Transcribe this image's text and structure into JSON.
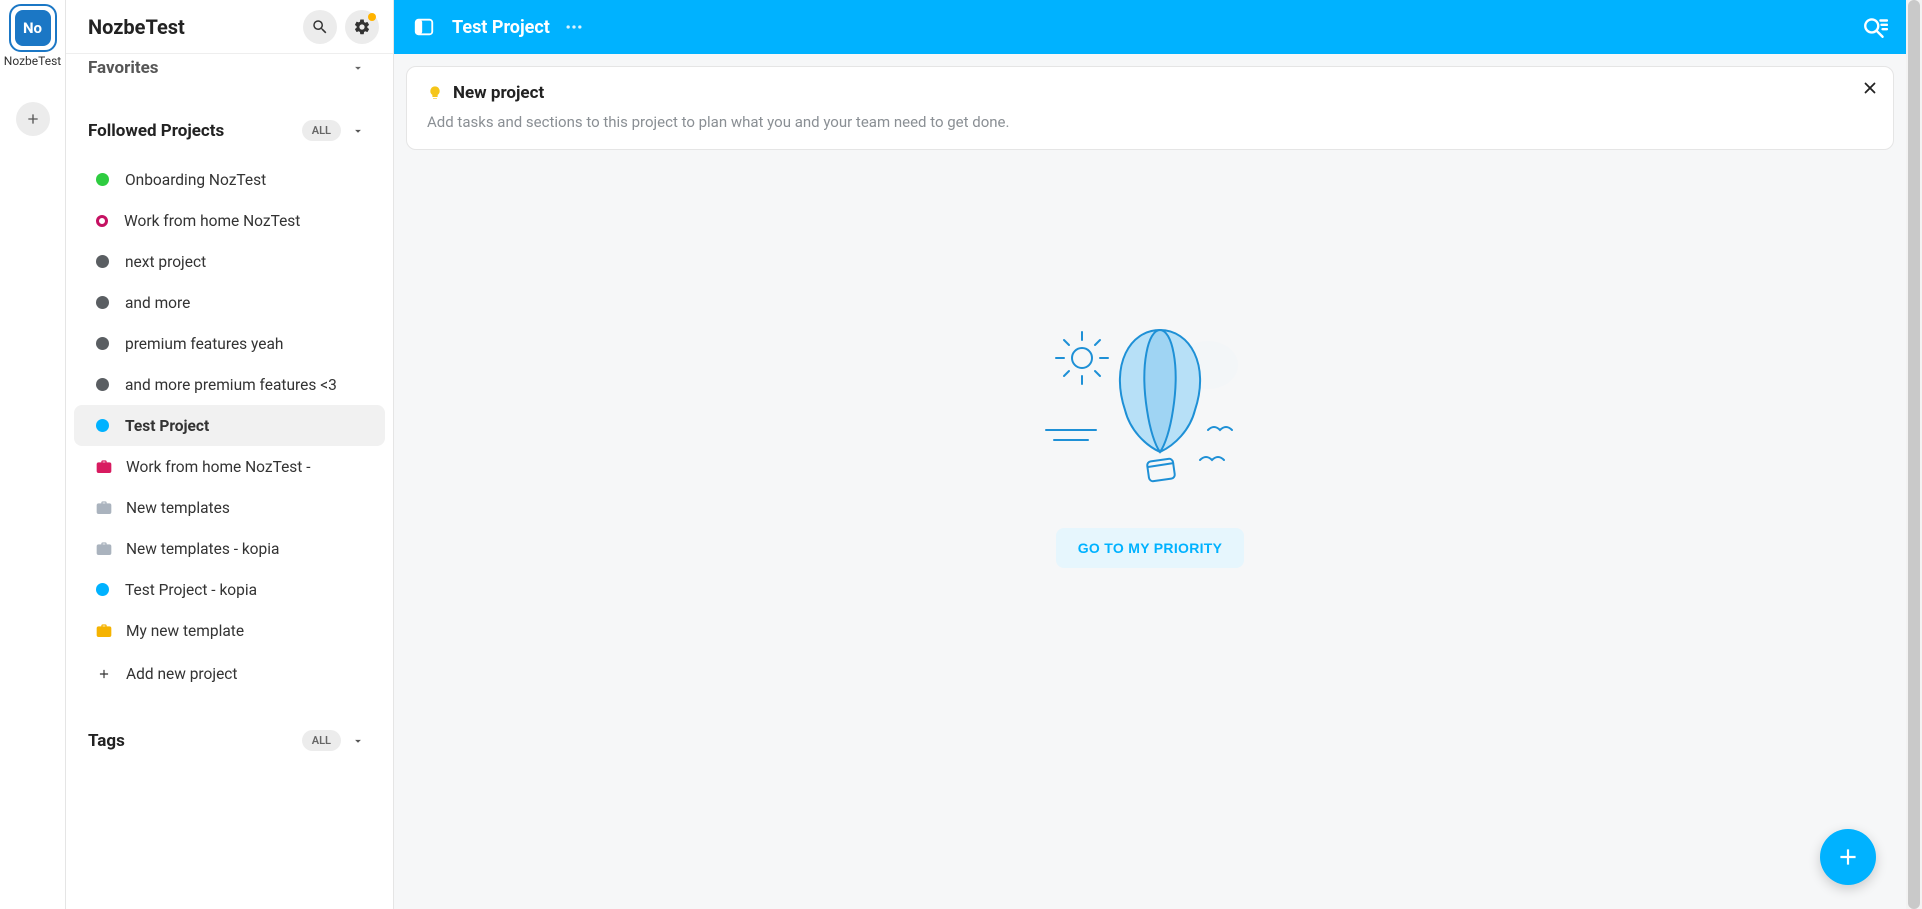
{
  "workspace": {
    "abbr": "No",
    "name": "NozbeTest"
  },
  "sidebar": {
    "title": "NozbeTest",
    "favorites_label": "Favorites",
    "followed_label": "Followed Projects",
    "tags_label": "Tags",
    "chip_all": "ALL",
    "add_project_label": "Add new project",
    "projects": [
      {
        "label": "Onboarding NozTest",
        "type": "dot",
        "color": "#2ecc40",
        "active": false
      },
      {
        "label": "Work from home NozTest",
        "type": "ring",
        "color": "#c51162",
        "active": false
      },
      {
        "label": "next project",
        "type": "dot",
        "color": "#5a5e62",
        "active": false
      },
      {
        "label": "and more",
        "type": "dot",
        "color": "#5a5e62",
        "active": false
      },
      {
        "label": "premium features yeah",
        "type": "dot",
        "color": "#5a5e62",
        "active": false
      },
      {
        "label": "and more premium features <3",
        "type": "dot",
        "color": "#5a5e62",
        "active": false
      },
      {
        "label": "Test Project",
        "type": "dot",
        "color": "#00b2ff",
        "active": true
      },
      {
        "label": "Work from home NozTest -",
        "type": "case",
        "color": "#d81b60",
        "active": false
      },
      {
        "label": "New templates",
        "type": "case",
        "color": "#aab3be",
        "active": false
      },
      {
        "label": "New templates - kopia",
        "type": "case",
        "color": "#aab3be",
        "active": false
      },
      {
        "label": "Test Project - kopia",
        "type": "dot",
        "color": "#00b2ff",
        "active": false
      },
      {
        "label": "My new template",
        "type": "case",
        "color": "#f5b301",
        "active": false
      }
    ]
  },
  "main": {
    "title": "Test Project",
    "hint_title": "New project",
    "hint_sub": "Add tasks and sections to this project to plan what you and your team need to get done.",
    "priority_button": "GO TO MY PRIORITY"
  }
}
